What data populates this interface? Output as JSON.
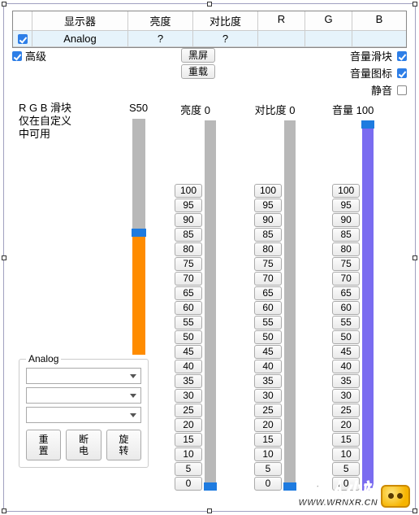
{
  "table": {
    "headers": [
      "",
      "显示器",
      "亮度",
      "对比度",
      "R",
      "G",
      "B"
    ],
    "row": {
      "checked": true,
      "monitor": "Analog",
      "brightness": "?",
      "contrast": "?",
      "r": "",
      "g": "",
      "b": ""
    }
  },
  "advanced": {
    "label": "高级",
    "checked": true
  },
  "center_buttons": {
    "black_screen": "黑屏",
    "reload": "重载"
  },
  "options": {
    "volume_slider": {
      "label": "音量滑块",
      "checked": true
    },
    "volume_icon": {
      "label": "音量图标",
      "checked": true
    },
    "mute": {
      "label": "静音",
      "checked": false
    }
  },
  "rgb_note": {
    "line1": "R G B 滑块",
    "line2": "仅在自定义",
    "line3": "中可用"
  },
  "sliders": {
    "s50": {
      "label": "S50",
      "value": 50,
      "max": 100
    },
    "brightness": {
      "label": "亮度 0",
      "value": 0,
      "max": 100
    },
    "contrast": {
      "label": "对比度 0",
      "value": 0,
      "max": 100
    },
    "volume": {
      "label": "音量 100",
      "value": 100,
      "max": 100
    }
  },
  "steps": [
    100,
    95,
    90,
    85,
    80,
    75,
    70,
    65,
    60,
    55,
    50,
    45,
    40,
    35,
    30,
    25,
    20,
    15,
    10,
    5,
    0
  ],
  "analog_group": {
    "legend": "Analog",
    "combo1": "",
    "combo2": "",
    "combo3": "",
    "buttons": {
      "reset": "重\n置",
      "power": "断\n电",
      "rotate": "旋\n转"
    }
  },
  "watermark": {
    "cn": "仙人小站",
    "url": "WWW.WRNXR.CN"
  },
  "chart_data": [
    {
      "type": "bar",
      "title": "S50",
      "categories": [
        "S"
      ],
      "values": [
        50
      ],
      "ylim": [
        0,
        100
      ]
    },
    {
      "type": "bar",
      "title": "亮度",
      "categories": [
        "亮度"
      ],
      "values": [
        0
      ],
      "ylim": [
        0,
        100
      ]
    },
    {
      "type": "bar",
      "title": "对比度",
      "categories": [
        "对比度"
      ],
      "values": [
        0
      ],
      "ylim": [
        0,
        100
      ]
    },
    {
      "type": "bar",
      "title": "音量",
      "categories": [
        "音量"
      ],
      "values": [
        100
      ],
      "ylim": [
        0,
        100
      ]
    }
  ]
}
